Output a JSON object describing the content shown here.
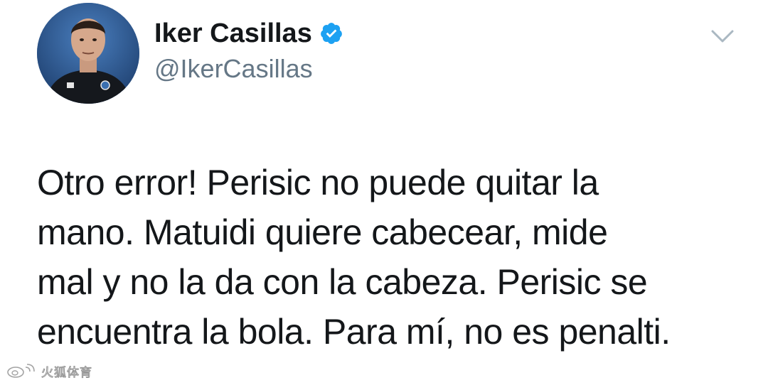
{
  "tweet": {
    "author": {
      "display_name": "Iker Casillas",
      "handle": "@IkerCasillas",
      "verified": true,
      "avatar_icon": "profile-photo"
    },
    "menu_icon": "chevron-down-icon",
    "text_lines": [
      "Otro error! Perisic no puede quitar la",
      "mano. Matuidi quiere cabecear, mide",
      "mal y no la da con la cabeza. Perisic se",
      "encuentra la bola. Para mí, no es penalti."
    ]
  },
  "watermark": {
    "icon": "weibo-logo-icon",
    "text": "火狐体育"
  },
  "colors": {
    "text_primary": "#14171a",
    "text_secondary": "#657786",
    "verified_blue": "#1da1f2",
    "chevron": "#aab8c2"
  }
}
